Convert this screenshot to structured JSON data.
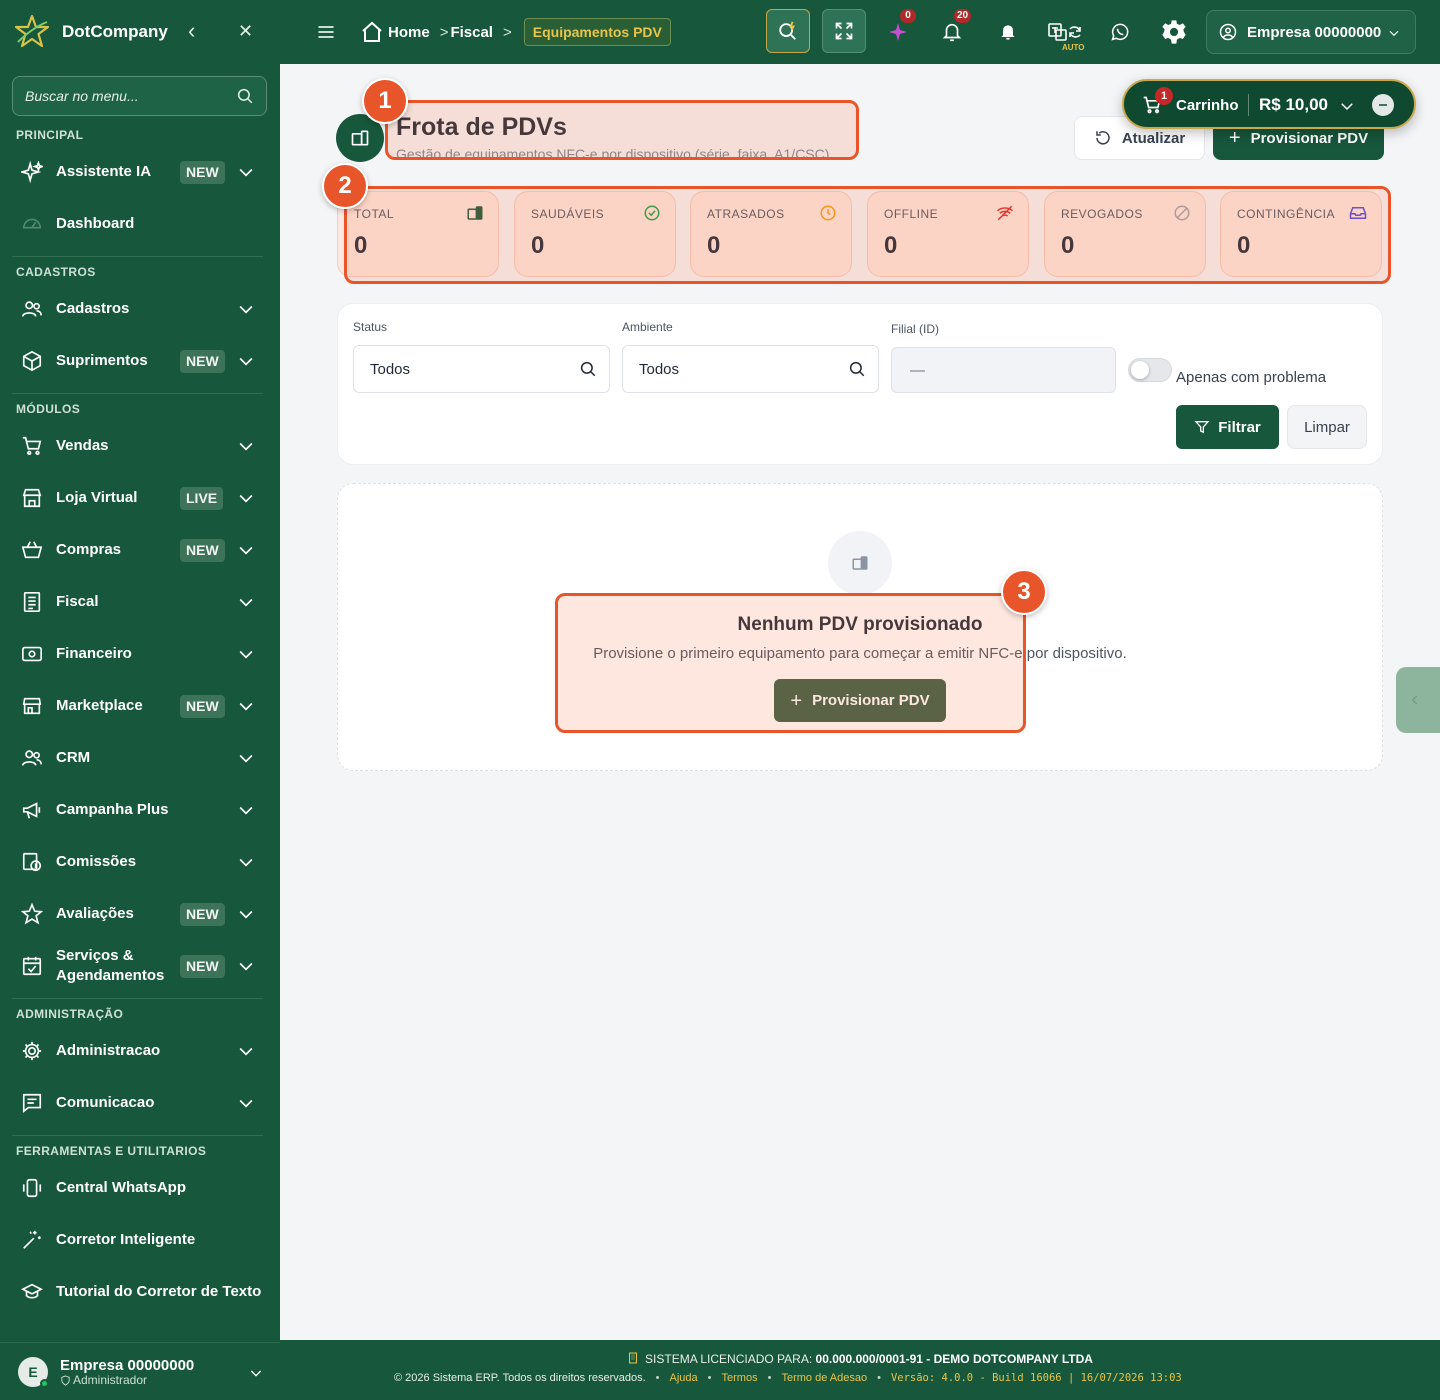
{
  "sidebar": {
    "brand": "DotCompany",
    "search_placeholder": "Buscar no menu...",
    "sections": {
      "principal": "PRINCIPAL",
      "cadastros": "CADASTROS",
      "modulos": "MÓDULOS",
      "administracao": "ADMINISTRAÇÃO",
      "ferramentas": "FERRAMENTAS E UTILITARIOS"
    },
    "items": [
      {
        "label": "Assistente IA",
        "badge": "NEW",
        "icon": "sparkles-icon"
      },
      {
        "label": "Dashboard",
        "icon": "gauge-icon"
      },
      {
        "label": "Cadastros",
        "icon": "users-icon"
      },
      {
        "label": "Suprimentos",
        "badge": "NEW",
        "icon": "box-icon"
      },
      {
        "label": "Vendas",
        "icon": "cart-icon"
      },
      {
        "label": "Loja Virtual",
        "badge": "LIVE",
        "icon": "store-icon"
      },
      {
        "label": "Compras",
        "badge": "NEW",
        "icon": "basket-icon"
      },
      {
        "label": "Fiscal",
        "icon": "receipt-icon"
      },
      {
        "label": "Financeiro",
        "icon": "money-icon"
      },
      {
        "label": "Marketplace",
        "badge": "NEW",
        "icon": "shop-icon"
      },
      {
        "label": "CRM",
        "icon": "people-icon"
      },
      {
        "label": "Campanha Plus",
        "icon": "megaphone-icon"
      },
      {
        "label": "Comissões",
        "icon": "commission-icon"
      },
      {
        "label": "Avaliações",
        "badge": "NEW",
        "icon": "star-icon"
      },
      {
        "label": "Serviços &\nAgendamentos",
        "badge": "NEW",
        "icon": "calendar-icon"
      },
      {
        "label": "Administracao",
        "icon": "gear-icon"
      },
      {
        "label": "Comunicacao",
        "icon": "message-icon"
      },
      {
        "label": "Central WhatsApp",
        "icon": "phone-vibrate-icon"
      },
      {
        "label": "Corretor Inteligente",
        "icon": "magic-wand-icon"
      },
      {
        "label": "Tutorial do Corretor de Texto",
        "icon": "graduation-cap-icon"
      }
    ],
    "user": {
      "initial": "E",
      "name": "Empresa 00000000",
      "role": "Administrador"
    }
  },
  "topbar": {
    "breadcrumb": {
      "home": "Home",
      "section": "Fiscal",
      "current": "Equipamentos PDV"
    },
    "magic_count": "0",
    "notif_count": "20",
    "auto_label": "AUTO",
    "company": "Empresa 00000000"
  },
  "cart": {
    "count": "1",
    "label": "Carrinho",
    "total": "R$ 10,00"
  },
  "page": {
    "title": "Frota de PDVs",
    "subtitle": "Gestão de equipamentos NFC-e por dispositivo (série, faixa, A1/CSC)",
    "refresh_label": "Atualizar",
    "provision_label": "Provisionar PDV"
  },
  "stats": [
    {
      "label": "TOTAL",
      "value": "0",
      "icon": "pdv-device-icon",
      "color": "#17573b"
    },
    {
      "label": "SAUDÁVEIS",
      "value": "0",
      "icon": "check-circle-icon",
      "color": "#16a34a"
    },
    {
      "label": "ATRASADOS",
      "value": "0",
      "icon": "clock-icon",
      "color": "#f59e0b"
    },
    {
      "label": "OFFLINE",
      "value": "0",
      "icon": "wifi-off-icon",
      "color": "#dc2626"
    },
    {
      "label": "REVOGADOS",
      "value": "0",
      "icon": "ban-icon",
      "color": "#9ca3af"
    },
    {
      "label": "CONTINGÊNCIA",
      "value": "0",
      "icon": "inbox-icon",
      "color": "#4f46e5"
    }
  ],
  "filters": {
    "status_label": "Status",
    "status_value": "Todos",
    "ambiente_label": "Ambiente",
    "ambiente_value": "Todos",
    "filial_label": "Filial (ID)",
    "filial_placeholder": "—",
    "toggle_label": "Apenas com problema",
    "toggle_on": false,
    "filter_button": "Filtrar",
    "clear_button": "Limpar"
  },
  "empty_state": {
    "title": "Nenhum PDV provisionado",
    "text": "Provisione o primeiro equipamento para começar a emitir NFC-e por dispositivo.",
    "button": "Provisionar PDV"
  },
  "annotations": [
    "1",
    "2",
    "3"
  ],
  "footer": {
    "license_prefix": "SISTEMA LICENCIADO PARA:",
    "license_holder": "00.000.000/0001-91 - DEMO DOTCOMPANY LTDA",
    "copyright": "© 2026 Sistema ERP. Todos os direitos reservados.",
    "links": [
      "Ajuda",
      "Termos",
      "Termo de Adesao"
    ],
    "version": "Versão: 4.0.0 - Build 16066 | 16/07/2026 13:03"
  },
  "colors": {
    "primary": "#17573b",
    "accent": "#e9c44a",
    "annotation": "#e8552a"
  }
}
